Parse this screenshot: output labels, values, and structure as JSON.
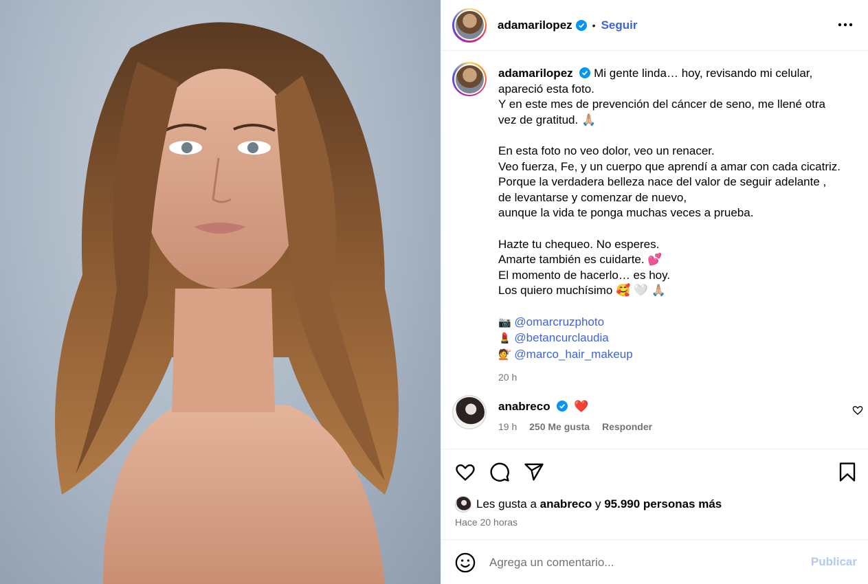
{
  "post": {
    "author": "adamarilopez",
    "follow_label": "Seguir",
    "separator": "•"
  },
  "caption": {
    "author": "adamarilopez",
    "lines": [
      "Mi gente linda… hoy, revisando mi celular,",
      "apareció esta foto.",
      "Y en este mes de prevención del cáncer de seno, me llené otra",
      "vez de gratitud. 🙏🏼",
      "",
      "En esta foto no veo dolor, veo un renacer.",
      "Veo fuerza, Fe, y un cuerpo que aprendí a amar con cada cicatriz.",
      "Porque la verdadera belleza nace del valor de seguir adelante ,",
      "de levantarse y comenzar de nuevo,",
      "aunque la vida te ponga muchas veces a prueba.",
      "",
      "Hazte tu chequeo. No esperes.",
      "Amarte también es cuidarte. 💕",
      "El momento de hacerlo… es hoy.",
      "Los quiero muchísimo 🥰 🤍 🙏🏼"
    ],
    "credits": [
      {
        "emoji": "📷",
        "mention": "@omarcruzphoto"
      },
      {
        "emoji": "💄",
        "mention": "@betancurclaudia"
      },
      {
        "emoji": "💇",
        "mention": "@marco_hair_makeup"
      }
    ],
    "time": "20 h"
  },
  "comment": {
    "author": "anabreco",
    "text": "❤️",
    "time": "19 h",
    "likes": "250 Me gusta",
    "reply": "Responder"
  },
  "likes_summary": {
    "prefix": "Les gusta a",
    "user": "anabreco",
    "conj": "y",
    "others": "95.990 personas más"
  },
  "post_time": "Hace 20 horas",
  "composer": {
    "placeholder": "Agrega un comentario...",
    "publish_label": "Publicar"
  },
  "icons": {
    "verified": "verified-badge-icon",
    "more": "more-options-icon",
    "like": "heart-icon",
    "comment": "comment-icon",
    "share": "share-icon",
    "save": "bookmark-icon",
    "emoji": "emoji-icon"
  },
  "colors": {
    "link": "#3b64d8",
    "verified": "#0095f6",
    "muted": "#737373",
    "publish_disabled": "#b3c9ee"
  }
}
